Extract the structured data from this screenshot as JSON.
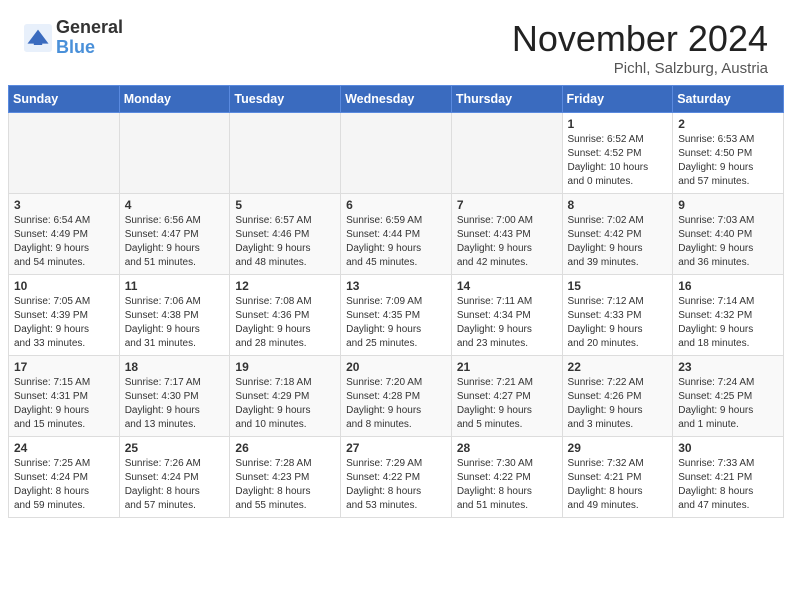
{
  "header": {
    "logo_general": "General",
    "logo_blue": "Blue",
    "title": "November 2024",
    "subtitle": "Pichl, Salzburg, Austria"
  },
  "weekdays": [
    "Sunday",
    "Monday",
    "Tuesday",
    "Wednesday",
    "Thursday",
    "Friday",
    "Saturday"
  ],
  "weeks": [
    [
      {
        "day": "",
        "info": ""
      },
      {
        "day": "",
        "info": ""
      },
      {
        "day": "",
        "info": ""
      },
      {
        "day": "",
        "info": ""
      },
      {
        "day": "",
        "info": ""
      },
      {
        "day": "1",
        "info": "Sunrise: 6:52 AM\nSunset: 4:52 PM\nDaylight: 10 hours\nand 0 minutes."
      },
      {
        "day": "2",
        "info": "Sunrise: 6:53 AM\nSunset: 4:50 PM\nDaylight: 9 hours\nand 57 minutes."
      }
    ],
    [
      {
        "day": "3",
        "info": "Sunrise: 6:54 AM\nSunset: 4:49 PM\nDaylight: 9 hours\nand 54 minutes."
      },
      {
        "day": "4",
        "info": "Sunrise: 6:56 AM\nSunset: 4:47 PM\nDaylight: 9 hours\nand 51 minutes."
      },
      {
        "day": "5",
        "info": "Sunrise: 6:57 AM\nSunset: 4:46 PM\nDaylight: 9 hours\nand 48 minutes."
      },
      {
        "day": "6",
        "info": "Sunrise: 6:59 AM\nSunset: 4:44 PM\nDaylight: 9 hours\nand 45 minutes."
      },
      {
        "day": "7",
        "info": "Sunrise: 7:00 AM\nSunset: 4:43 PM\nDaylight: 9 hours\nand 42 minutes."
      },
      {
        "day": "8",
        "info": "Sunrise: 7:02 AM\nSunset: 4:42 PM\nDaylight: 9 hours\nand 39 minutes."
      },
      {
        "day": "9",
        "info": "Sunrise: 7:03 AM\nSunset: 4:40 PM\nDaylight: 9 hours\nand 36 minutes."
      }
    ],
    [
      {
        "day": "10",
        "info": "Sunrise: 7:05 AM\nSunset: 4:39 PM\nDaylight: 9 hours\nand 33 minutes."
      },
      {
        "day": "11",
        "info": "Sunrise: 7:06 AM\nSunset: 4:38 PM\nDaylight: 9 hours\nand 31 minutes."
      },
      {
        "day": "12",
        "info": "Sunrise: 7:08 AM\nSunset: 4:36 PM\nDaylight: 9 hours\nand 28 minutes."
      },
      {
        "day": "13",
        "info": "Sunrise: 7:09 AM\nSunset: 4:35 PM\nDaylight: 9 hours\nand 25 minutes."
      },
      {
        "day": "14",
        "info": "Sunrise: 7:11 AM\nSunset: 4:34 PM\nDaylight: 9 hours\nand 23 minutes."
      },
      {
        "day": "15",
        "info": "Sunrise: 7:12 AM\nSunset: 4:33 PM\nDaylight: 9 hours\nand 20 minutes."
      },
      {
        "day": "16",
        "info": "Sunrise: 7:14 AM\nSunset: 4:32 PM\nDaylight: 9 hours\nand 18 minutes."
      }
    ],
    [
      {
        "day": "17",
        "info": "Sunrise: 7:15 AM\nSunset: 4:31 PM\nDaylight: 9 hours\nand 15 minutes."
      },
      {
        "day": "18",
        "info": "Sunrise: 7:17 AM\nSunset: 4:30 PM\nDaylight: 9 hours\nand 13 minutes."
      },
      {
        "day": "19",
        "info": "Sunrise: 7:18 AM\nSunset: 4:29 PM\nDaylight: 9 hours\nand 10 minutes."
      },
      {
        "day": "20",
        "info": "Sunrise: 7:20 AM\nSunset: 4:28 PM\nDaylight: 9 hours\nand 8 minutes."
      },
      {
        "day": "21",
        "info": "Sunrise: 7:21 AM\nSunset: 4:27 PM\nDaylight: 9 hours\nand 5 minutes."
      },
      {
        "day": "22",
        "info": "Sunrise: 7:22 AM\nSunset: 4:26 PM\nDaylight: 9 hours\nand 3 minutes."
      },
      {
        "day": "23",
        "info": "Sunrise: 7:24 AM\nSunset: 4:25 PM\nDaylight: 9 hours\nand 1 minute."
      }
    ],
    [
      {
        "day": "24",
        "info": "Sunrise: 7:25 AM\nSunset: 4:24 PM\nDaylight: 8 hours\nand 59 minutes."
      },
      {
        "day": "25",
        "info": "Sunrise: 7:26 AM\nSunset: 4:24 PM\nDaylight: 8 hours\nand 57 minutes."
      },
      {
        "day": "26",
        "info": "Sunrise: 7:28 AM\nSunset: 4:23 PM\nDaylight: 8 hours\nand 55 minutes."
      },
      {
        "day": "27",
        "info": "Sunrise: 7:29 AM\nSunset: 4:22 PM\nDaylight: 8 hours\nand 53 minutes."
      },
      {
        "day": "28",
        "info": "Sunrise: 7:30 AM\nSunset: 4:22 PM\nDaylight: 8 hours\nand 51 minutes."
      },
      {
        "day": "29",
        "info": "Sunrise: 7:32 AM\nSunset: 4:21 PM\nDaylight: 8 hours\nand 49 minutes."
      },
      {
        "day": "30",
        "info": "Sunrise: 7:33 AM\nSunset: 4:21 PM\nDaylight: 8 hours\nand 47 minutes."
      }
    ]
  ]
}
